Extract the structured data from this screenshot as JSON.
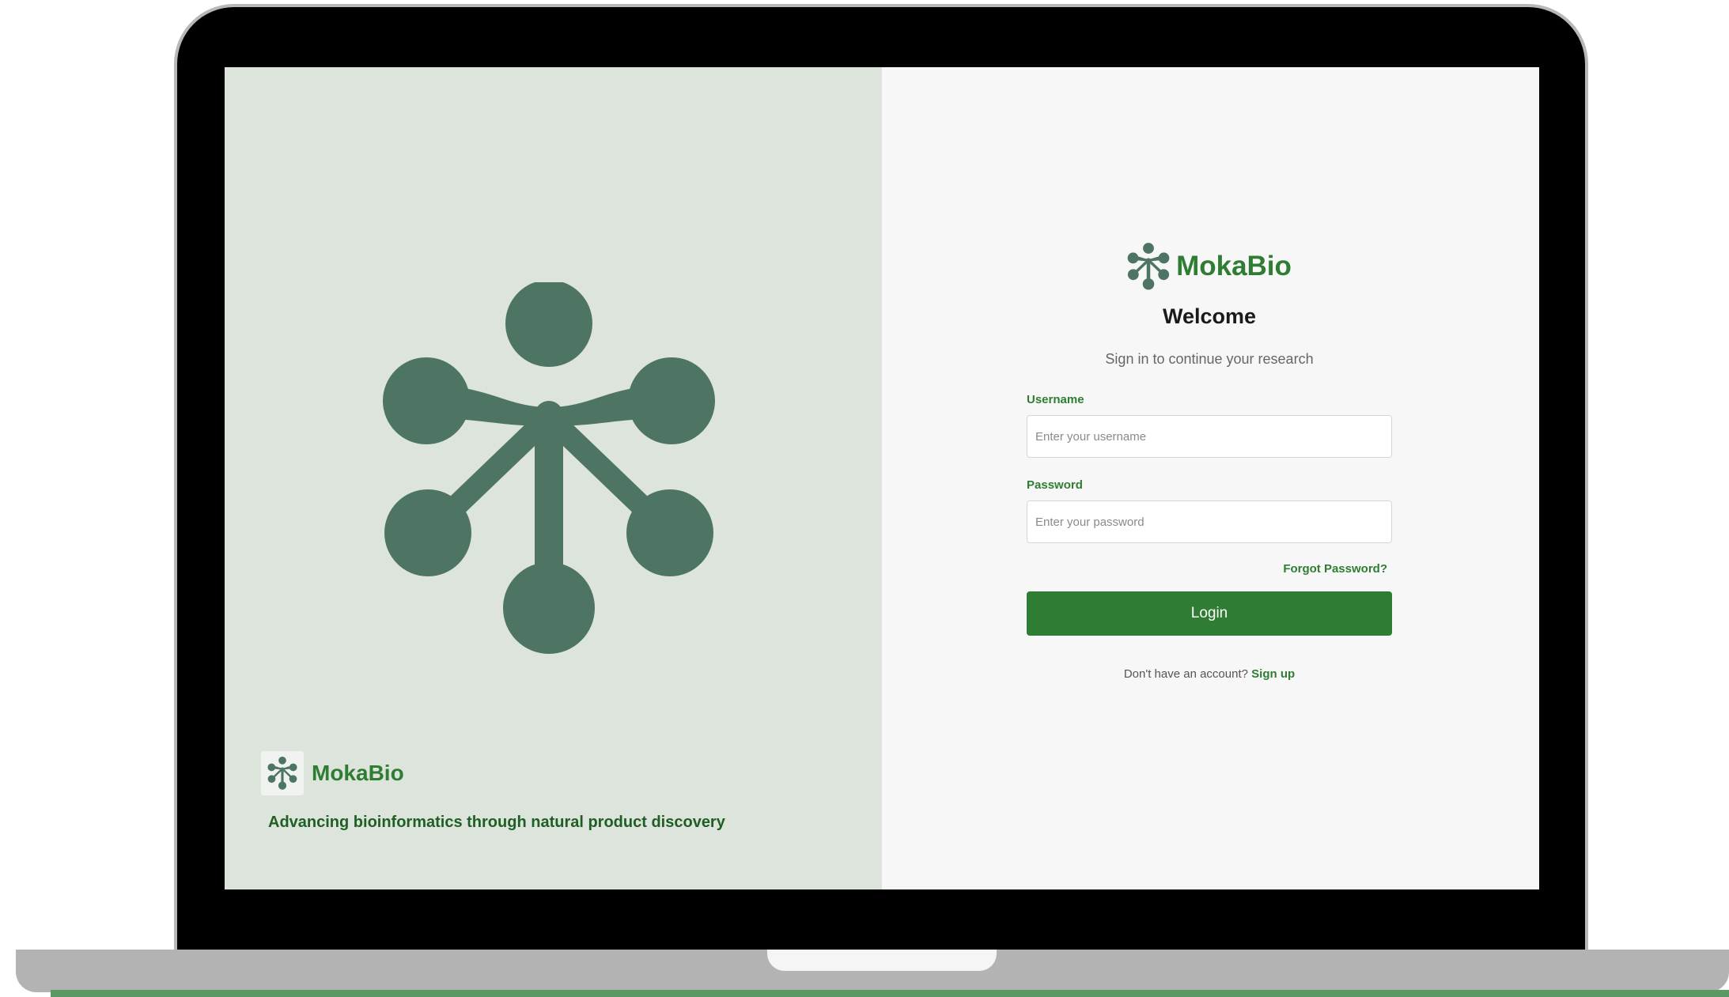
{
  "brand": {
    "name": "MokaBio",
    "tagline": "Advancing bioinformatics through natural product discovery",
    "logo_icon": "molecule-icon",
    "primary_color": "#2e7d32",
    "logo_color": "#4e7563",
    "left_panel_bg": "#dce4dc"
  },
  "login": {
    "title": "Welcome",
    "subtitle": "Sign in to continue your research",
    "username_label": "Username",
    "username_placeholder": "Enter your username",
    "username_value": "",
    "password_label": "Password",
    "password_placeholder": "Enter your password",
    "password_value": "",
    "forgot_password": "Forgot Password?",
    "login_button": "Login",
    "signup_prompt": "Don't have an account?",
    "signup_link": "Sign up"
  }
}
